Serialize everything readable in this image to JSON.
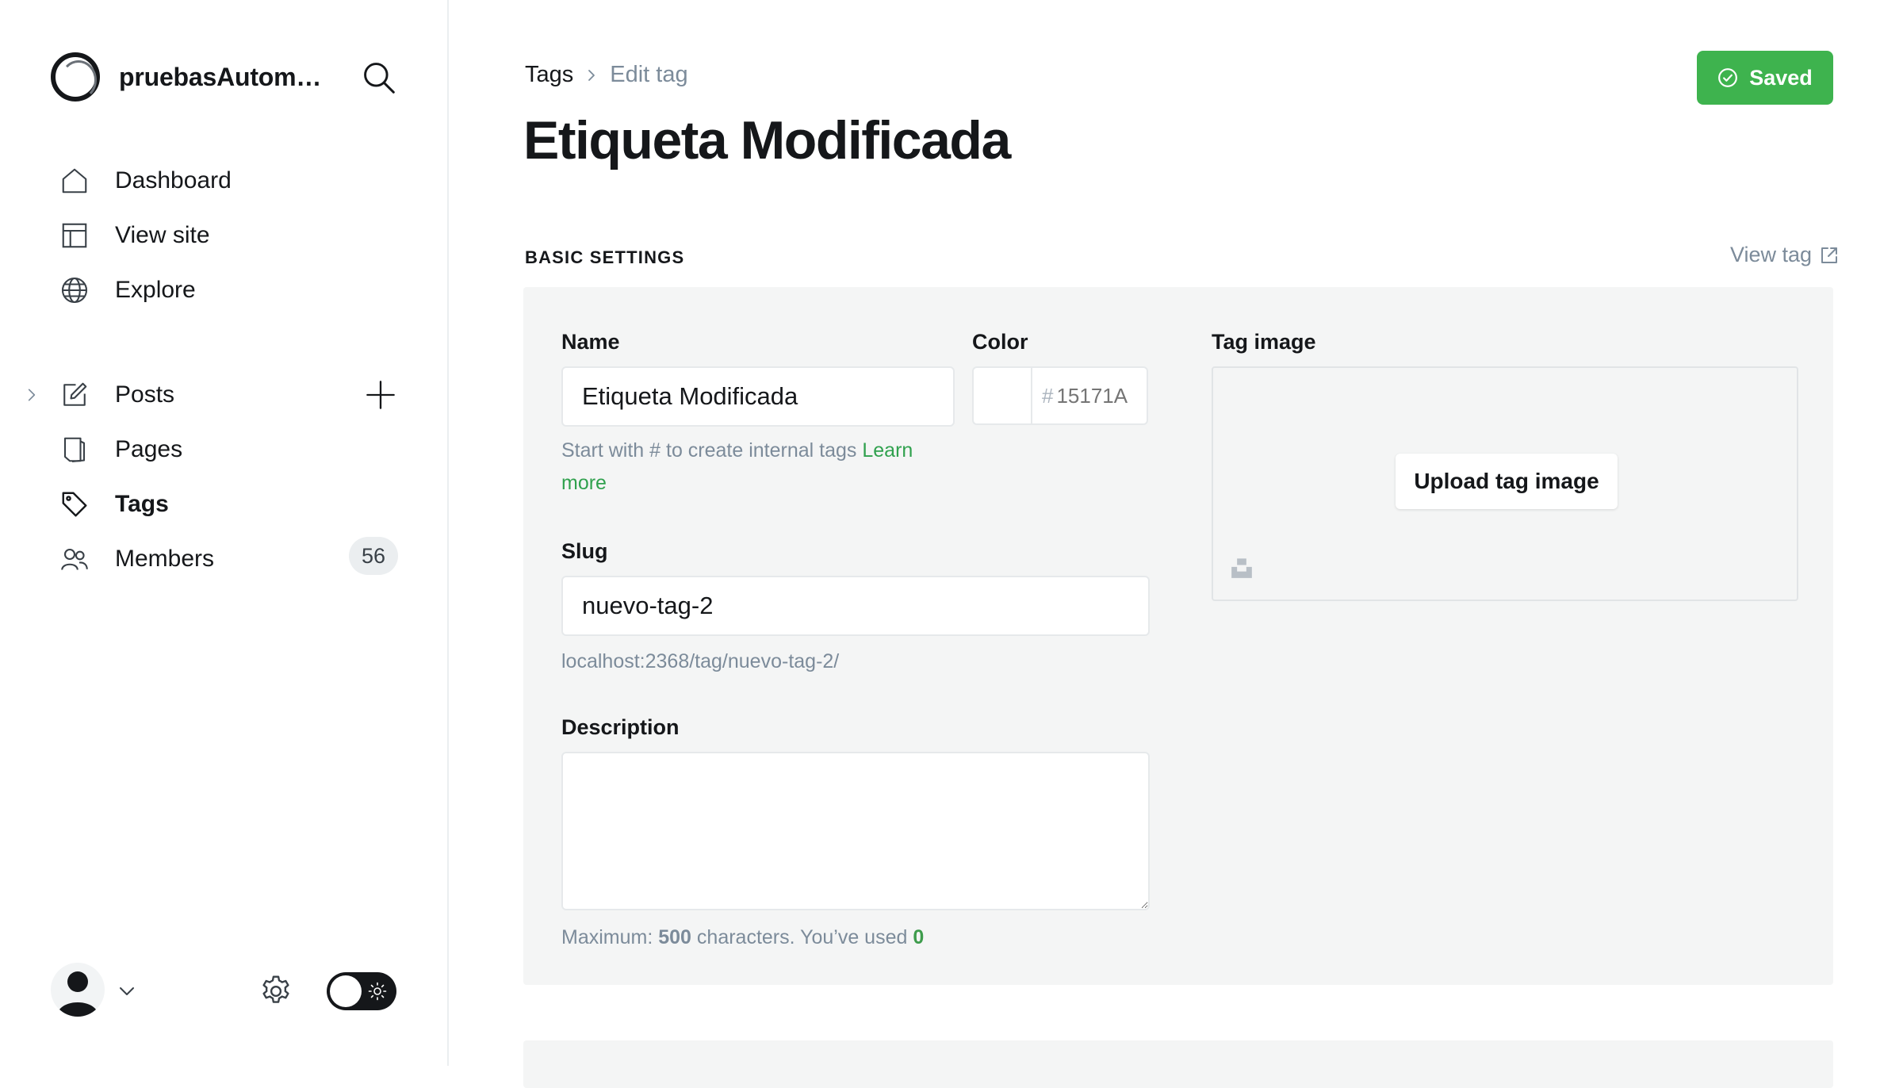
{
  "sidebar": {
    "brand_name": "pruebasAutoma...",
    "nav_top": [
      {
        "label": "Dashboard",
        "icon": "home-icon"
      },
      {
        "label": "View site",
        "icon": "layout-icon"
      },
      {
        "label": "Explore",
        "icon": "globe-icon"
      }
    ],
    "nav_main": [
      {
        "label": "Posts",
        "icon": "edit-icon"
      },
      {
        "label": "Pages",
        "icon": "pages-icon"
      },
      {
        "label": "Tags",
        "icon": "tag-icon",
        "active": true
      },
      {
        "label": "Members",
        "icon": "members-icon",
        "count": "56"
      }
    ]
  },
  "header": {
    "breadcrumb_parent": "Tags",
    "breadcrumb_current": "Edit tag",
    "title": "Etiqueta Modificada",
    "saved_label": "Saved"
  },
  "section": {
    "title": "BASIC SETTINGS",
    "view_tag": "View tag"
  },
  "form": {
    "name_label": "Name",
    "name_value": "Etiqueta Modificada",
    "name_hint": "Start with # to create internal tags",
    "learn_more_1": "Learn",
    "learn_more_2": "more",
    "color_label": "Color",
    "color_hash": "#",
    "color_placeholder": "15171A",
    "slug_label": "Slug",
    "slug_value": "nuevo-tag-2",
    "slug_url": "localhost:2368/tag/nuevo-tag-2/",
    "description_label": "Description",
    "description_value": "",
    "desc_hint_prefix": "Maximum:",
    "desc_hint_max": "500",
    "desc_hint_middle": "characters. You’ve used",
    "desc_hint_used": "0",
    "tag_image_label": "Tag image",
    "upload_label": "Upload tag image"
  },
  "colors": {
    "accent_green": "#3eb34e",
    "text": "#15171a",
    "muted": "#7c8b9a",
    "panel_bg": "#f4f5f5"
  }
}
